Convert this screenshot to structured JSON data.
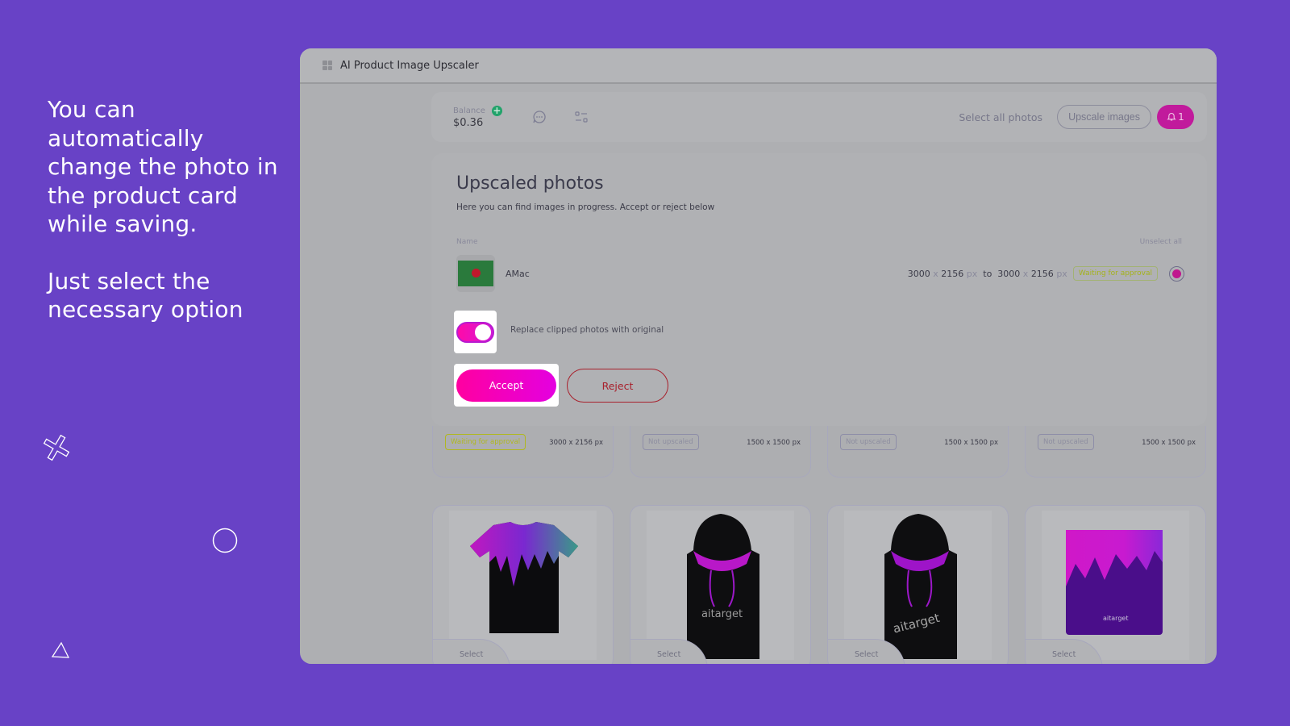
{
  "promo": {
    "paragraph1": "You can automatically change the photo in the product card while saving.",
    "paragraph2": "Just select the necessary option"
  },
  "window": {
    "title": "AI Product Image Upscaler",
    "app_icon": "grid-icon"
  },
  "topbar": {
    "balance_label": "Balance",
    "balance_value": "$0.36",
    "add_funds_icon": "plus-icon",
    "chat_icon": "chat-icon",
    "settings_icon": "sliders-icon",
    "select_all_label": "Select all photos",
    "upscale_label": "Upscale images",
    "notification_icon": "bell-icon",
    "notification_count": "1"
  },
  "panel": {
    "title": "Upscaled photos",
    "subtitle": "Here you can find images in progress. Accept or reject below",
    "column_name": "Name",
    "unselect_all_label": "Unselect all",
    "item": {
      "name": "AMac",
      "from_w": "3000",
      "from_h": "2156",
      "to_w": "3000",
      "to_h": "2156",
      "unit": "px",
      "x": "x",
      "to_label": "to",
      "status": "Waiting for approval",
      "selected": true
    },
    "toggle_label": "Replace clipped photos with original",
    "toggle_on": true,
    "accept_label": "Accept",
    "reject_label": "Reject"
  },
  "strips": [
    {
      "status": "Waiting for approval",
      "status_type": "waiting",
      "dims": "3000 x 2156 px"
    },
    {
      "status": "Not upscaled",
      "status_type": "not",
      "dims": "1500 x 1500 px"
    },
    {
      "status": "Not upscaled",
      "status_type": "not",
      "dims": "1500 x 1500 px"
    },
    {
      "status": "Not upscaled",
      "status_type": "not",
      "dims": "1500 x 1500 px"
    }
  ],
  "products": [
    {
      "kind": "t-shirt",
      "select_label": "Select"
    },
    {
      "kind": "hoodie",
      "brand_text": "aitarget",
      "select_label": "Select"
    },
    {
      "kind": "hoodie",
      "brand_text": "aitarget",
      "select_label": "Select"
    },
    {
      "kind": "mug",
      "brand_text": "aitarget",
      "select_label": "Select"
    }
  ],
  "colors": {
    "background": "#6842c6",
    "accent_pink": "#ff00a0",
    "reject_red": "#a8202c",
    "waiting_yellow": "#b0b820"
  }
}
